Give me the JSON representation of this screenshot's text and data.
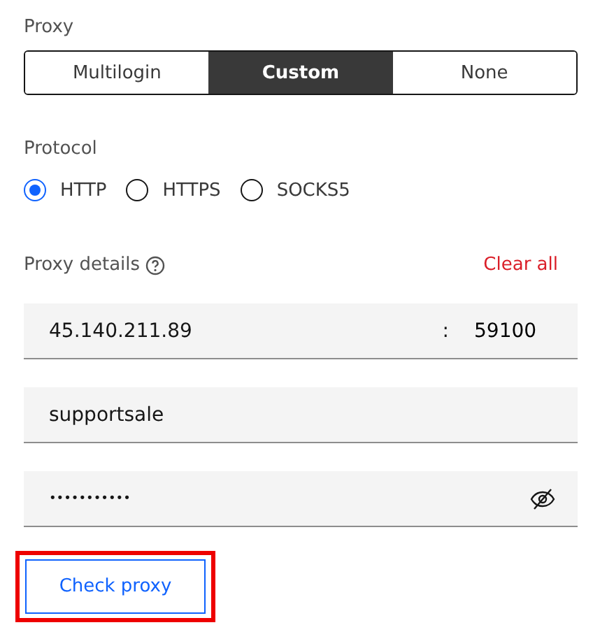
{
  "proxy": {
    "label": "Proxy",
    "options": [
      {
        "label": "Multilogin",
        "selected": false
      },
      {
        "label": "Custom",
        "selected": true
      },
      {
        "label": "None",
        "selected": false
      }
    ]
  },
  "protocol": {
    "label": "Protocol",
    "options": [
      {
        "label": "HTTP",
        "selected": true
      },
      {
        "label": "HTTPS",
        "selected": false
      },
      {
        "label": "SOCKS5",
        "selected": false
      }
    ]
  },
  "details": {
    "label": "Proxy details",
    "clear": "Clear all",
    "host": "45.140.211.89",
    "separator": ":",
    "port": "59100",
    "username": "supportsale",
    "password": "•••••••••••"
  },
  "check_button": {
    "label": "Check proxy",
    "highlighted": true
  }
}
